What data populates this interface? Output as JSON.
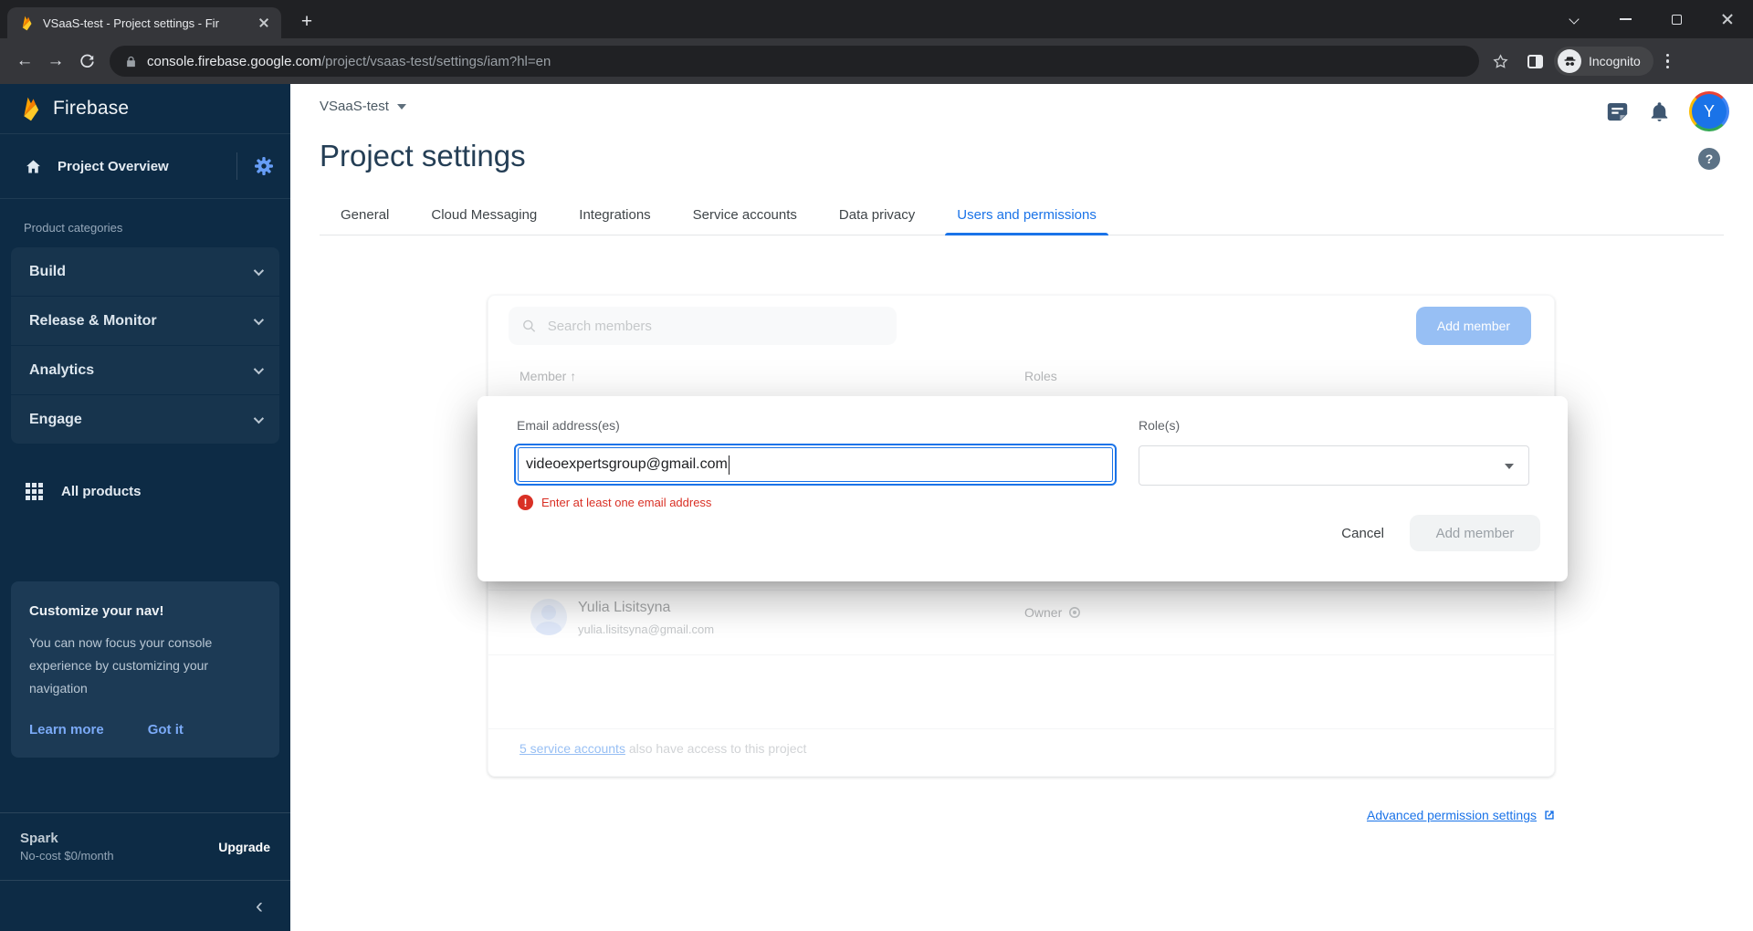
{
  "browser": {
    "tab_title": "VSaaS-test - Project settings - Fir",
    "url_domain": "console.firebase.google.com",
    "url_path": "/project/vsaas-test/settings/iam?hl=en",
    "incognito_label": "Incognito"
  },
  "sidebar": {
    "brand": "Firebase",
    "project_overview": "Project Overview",
    "section_label": "Product categories",
    "categories": [
      {
        "label": "Build"
      },
      {
        "label": "Release & Monitor"
      },
      {
        "label": "Analytics"
      },
      {
        "label": "Engage"
      }
    ],
    "all_products": "All products",
    "promo": {
      "title": "Customize your nav!",
      "body": "You can now focus your console experience by customizing your navigation",
      "learn_more": "Learn more",
      "got_it": "Got it"
    },
    "plan": {
      "name": "Spark",
      "detail": "No-cost $0/month",
      "action": "Upgrade"
    }
  },
  "header": {
    "project_name": "VSaaS-test",
    "title": "Project settings",
    "avatar_initial": "Y",
    "help_glyph": "?"
  },
  "tabs": [
    {
      "label": "General"
    },
    {
      "label": "Cloud Messaging"
    },
    {
      "label": "Integrations"
    },
    {
      "label": "Service accounts"
    },
    {
      "label": "Data privacy"
    },
    {
      "label": "Users and permissions"
    }
  ],
  "members_panel": {
    "search_placeholder": "Search members",
    "add_member_label": "Add member",
    "columns": {
      "member": "Member",
      "sort_arrow": "↑",
      "roles": "Roles"
    },
    "rows": [
      {
        "name": "Yulia Lisitsyna",
        "email": "yulia.lisitsyna@gmail.com",
        "role": "Owner"
      }
    ],
    "service_accounts_link": "5 service accounts",
    "service_accounts_rest": " also have access to this project"
  },
  "advanced_link": "Advanced permission settings",
  "dialog": {
    "email_label": "Email address(es)",
    "email_value": "videoexpertsgroup@gmail.com",
    "error_text": "Enter at least one email address",
    "error_glyph": "!",
    "role_label": "Role(s)",
    "cancel_label": "Cancel",
    "add_member_label": "Add member"
  },
  "colors": {
    "accent": "#1a73e8",
    "error": "#d93025",
    "sidebar_bg": "#0d2b45",
    "browser_dark": "#202124",
    "browser_toolbar": "#35363a"
  }
}
